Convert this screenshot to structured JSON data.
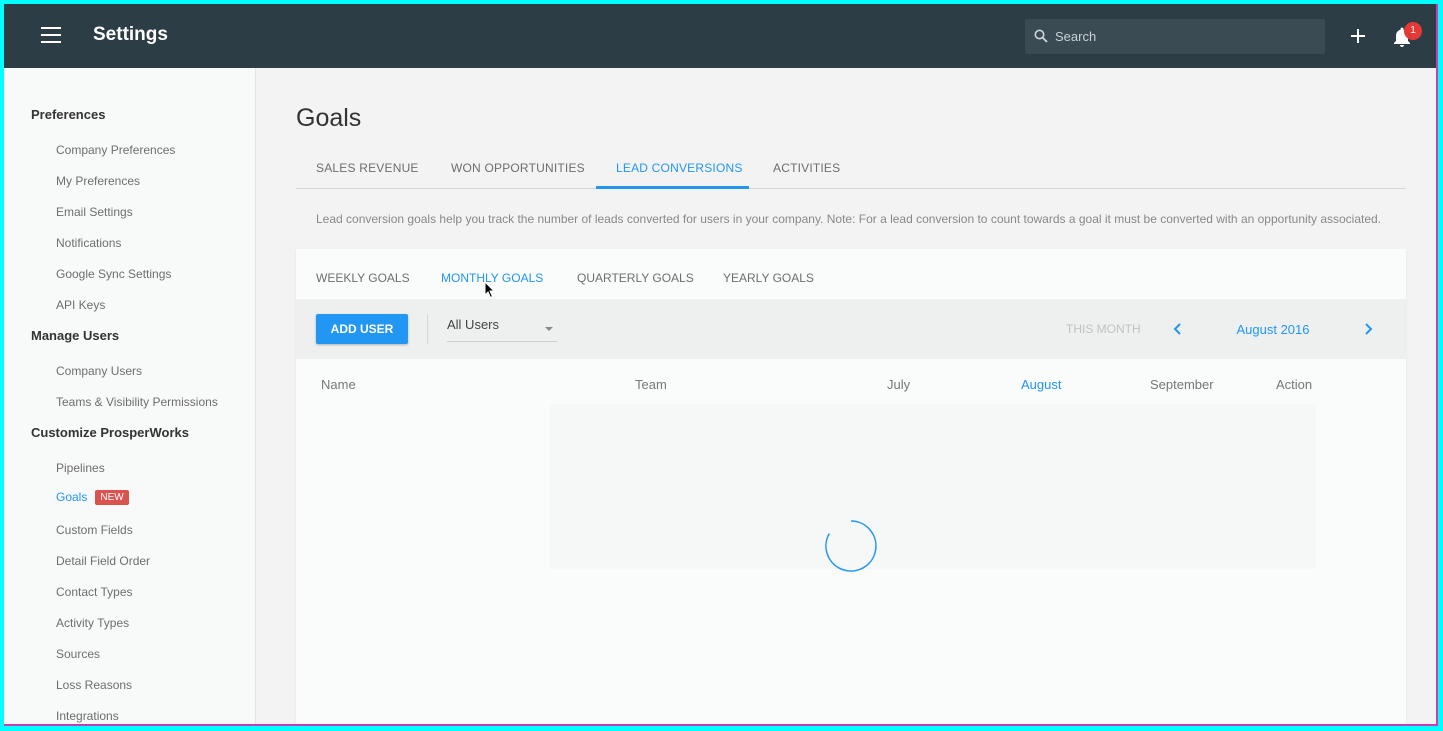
{
  "header": {
    "title": "Settings",
    "search_placeholder": "Search",
    "notification_count": "1"
  },
  "sidebar": {
    "sections": [
      {
        "label": "Preferences"
      },
      {
        "label": "Manage Users"
      },
      {
        "label": "Customize ProsperWorks"
      }
    ],
    "items": [
      {
        "label": "Company Preferences"
      },
      {
        "label": "My Preferences"
      },
      {
        "label": "Email Settings"
      },
      {
        "label": "Notifications"
      },
      {
        "label": "Google Sync Settings"
      },
      {
        "label": "API Keys"
      },
      {
        "label": "Company Users"
      },
      {
        "label": "Teams & Visibility Permissions"
      },
      {
        "label": "Pipelines"
      },
      {
        "label": "Goals",
        "badge": "NEW",
        "active": true
      },
      {
        "label": "Custom Fields"
      },
      {
        "label": "Detail Field Order"
      },
      {
        "label": "Contact Types"
      },
      {
        "label": "Activity Types"
      },
      {
        "label": "Sources"
      },
      {
        "label": "Loss Reasons"
      },
      {
        "label": "Integrations"
      }
    ]
  },
  "main": {
    "title": "Goals",
    "tabs": [
      {
        "label": "SALES REVENUE"
      },
      {
        "label": "WON OPPORTUNITIES"
      },
      {
        "label": "LEAD CONVERSIONS",
        "active": true
      },
      {
        "label": "ACTIVITIES"
      }
    ],
    "description": "Lead conversion goals help you track the number of leads converted for users in your company. Note: For a lead conversion to count towards a goal it must be converted with an opportunity associated.",
    "subtabs": [
      {
        "label": "WEEKLY GOALS"
      },
      {
        "label": "MONTHLY GOALS",
        "active": true
      },
      {
        "label": "QUARTERLY GOALS"
      },
      {
        "label": "YEARLY GOALS"
      }
    ],
    "toolbar": {
      "add_user_label": "ADD USER",
      "user_filter_value": "All Users",
      "this_month_label": "THIS MONTH",
      "current_period": "August 2016"
    },
    "table": {
      "columns": [
        "Name",
        "Team",
        "July",
        "August",
        "September",
        "Action"
      ],
      "active_column": "August",
      "rows": []
    }
  },
  "colors": {
    "accent": "#2196f3",
    "topbar": "#2c3d46",
    "badge_red": "#d9534f"
  },
  "icons": [
    "hamburger-icon",
    "search-icon",
    "plus-icon",
    "bell-icon",
    "chevron-left-icon",
    "chevron-right-icon",
    "caret-down-icon",
    "loading-spinner"
  ]
}
